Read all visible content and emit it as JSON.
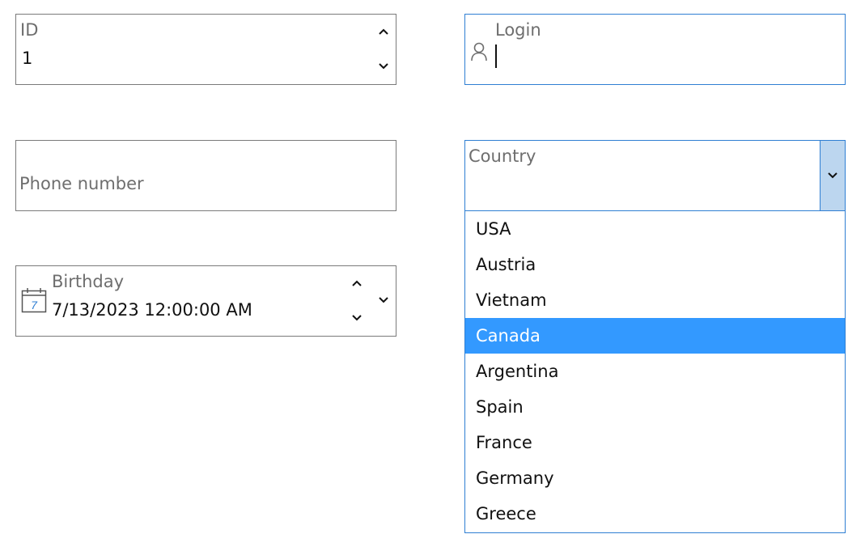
{
  "id_field": {
    "label": "ID",
    "value": "1"
  },
  "login_field": {
    "label": "Login",
    "value": ""
  },
  "phone_field": {
    "placeholder": "Phone number"
  },
  "country_field": {
    "label": "Country",
    "options": [
      "USA",
      "Austria",
      "Vietnam",
      "Canada",
      "Argentina",
      "Spain",
      "France",
      "Germany",
      "Greece"
    ],
    "highlighted": "Canada"
  },
  "birthday_field": {
    "label": "Birthday",
    "value": "7/13/2023 12:00:00 AM",
    "calendar_day": "7"
  },
  "icons": {
    "id_up": "chevron-up-icon",
    "id_down": "chevron-down-icon",
    "login": "user-icon",
    "country_toggle": "chevron-down-icon",
    "birthday_calendar": "calendar-icon",
    "birthday_up": "chevron-up-icon",
    "birthday_down": "chevron-down-icon",
    "birthday_dropdown": "chevron-down-icon"
  },
  "colors": {
    "focus_border": "#2f7fd3",
    "selection": "#3399ff",
    "combo_button": "#bcd6ef",
    "label_gray": "#6e6e6e"
  }
}
